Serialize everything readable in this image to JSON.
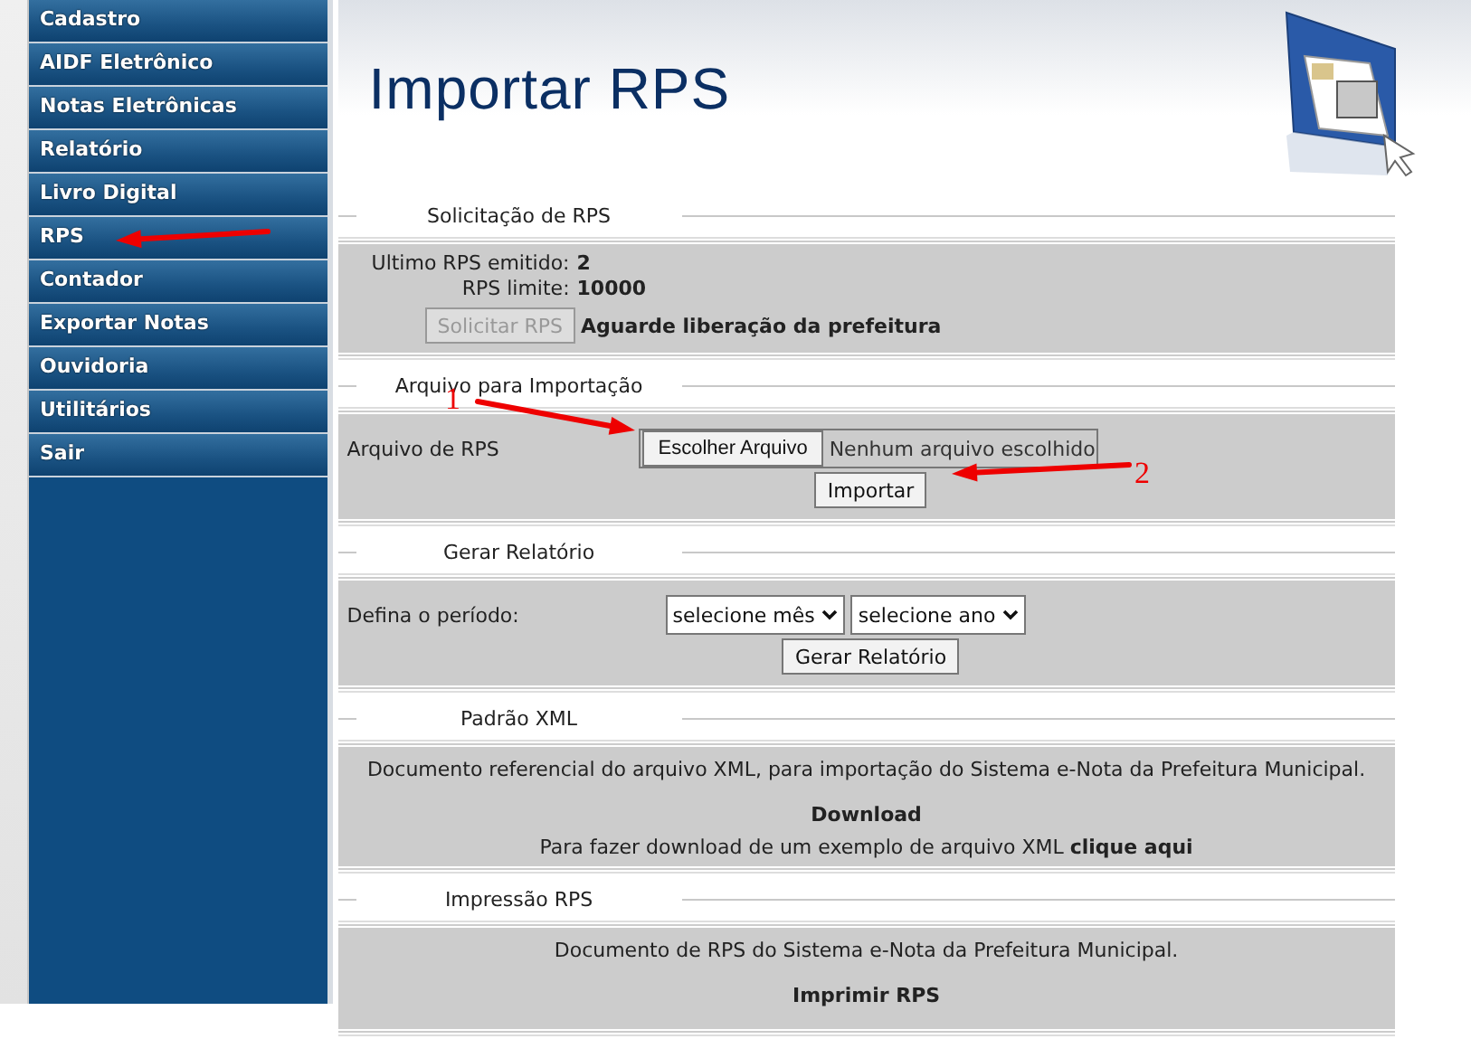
{
  "sidebar": {
    "items": [
      {
        "label": "Cadastro"
      },
      {
        "label": "AIDF Eletrônico"
      },
      {
        "label": "Notas Eletrônicas"
      },
      {
        "label": "Relatório"
      },
      {
        "label": "Livro Digital"
      },
      {
        "label": "RPS"
      },
      {
        "label": "Contador"
      },
      {
        "label": "Exportar Notas"
      },
      {
        "label": "Ouvidoria"
      },
      {
        "label": "Utilitários"
      },
      {
        "label": "Sair"
      }
    ]
  },
  "page_title": "Importar RPS",
  "sections": [
    {
      "kind": "request",
      "title": "Solicitação de RPS",
      "rows": [
        {
          "label": "Ultimo RPS emitido:",
          "value": "2"
        },
        {
          "label": "RPS limite:",
          "value": "10000"
        }
      ],
      "button": {
        "label": "Solicitar RPS",
        "disabled": true
      },
      "message": "Aguarde liberação da prefeitura"
    },
    {
      "kind": "import",
      "title": "Arquivo para Importação",
      "field_label": "Arquivo de RPS",
      "file_button": "Escolher Arquivo",
      "file_status": "Nenhum arquivo escolhido",
      "button": "Importar"
    },
    {
      "kind": "report",
      "title": "Gerar Relatório",
      "field_label": "Defina o período:",
      "selects": [
        {
          "value": "selecione mês"
        },
        {
          "value": "selecione ano"
        }
      ],
      "button": "Gerar Relatório"
    },
    {
      "kind": "info",
      "title": "Padrão XML",
      "description": "Documento referencial do arquivo XML, para importação do Sistema e-Nota da Prefeitura Municipal.",
      "link": "Download",
      "note": "Para fazer download de um exemplo de arquivo XML",
      "note_link": "clique aqui"
    },
    {
      "kind": "info",
      "title": "Impressão RPS",
      "description": "Documento de RPS do Sistema e-Nota da Prefeitura Municipal.",
      "link": "Imprimir RPS"
    }
  ],
  "annotations": [
    {
      "label": "1"
    },
    {
      "label": "2"
    }
  ]
}
